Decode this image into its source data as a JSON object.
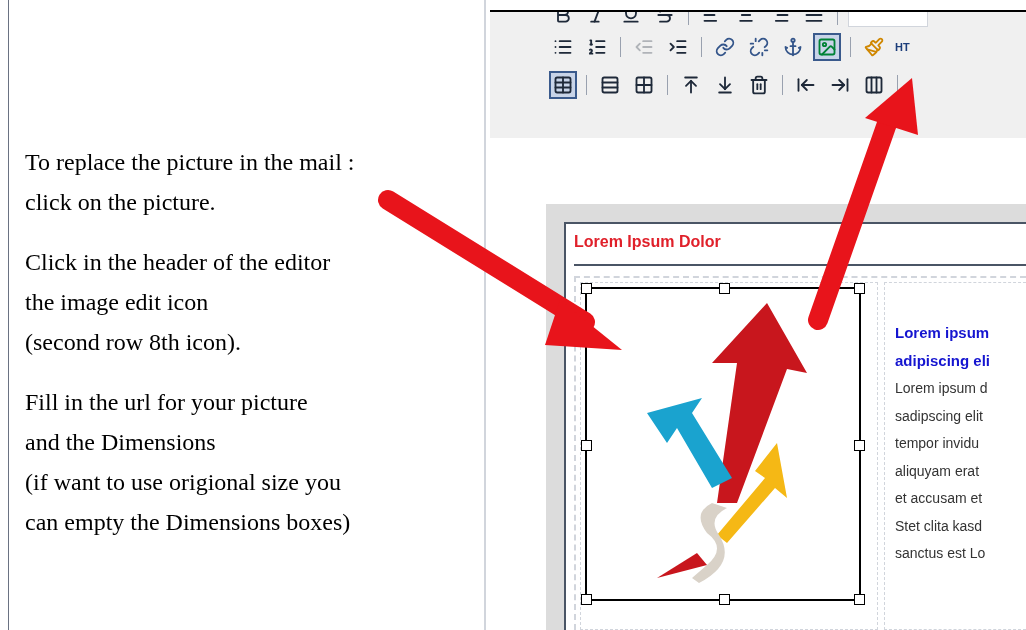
{
  "instructions": [
    [
      "To replace the picture in the mail :",
      "click on the picture."
    ],
    [
      "Click in the header of the editor",
      "the image edit icon",
      "(second row 8th icon)."
    ],
    [
      "Fill in the url for your picture",
      "and the Dimensions",
      "(if want to use origional size you",
      "can empty the Dimensions boxes)"
    ]
  ],
  "toolbar": {
    "rows": [
      [
        {
          "kind": "bold"
        },
        {
          "kind": "italic"
        },
        {
          "kind": "underline"
        },
        {
          "kind": "strike"
        },
        {
          "kind": "sep"
        },
        {
          "kind": "align-left"
        },
        {
          "kind": "align-center"
        },
        {
          "kind": "align-right"
        },
        {
          "kind": "align-justify"
        },
        {
          "kind": "sep"
        },
        {
          "kind": "font-select"
        }
      ],
      [
        {
          "kind": "bullets",
          "selected": false
        },
        {
          "kind": "numbers",
          "selected": false
        },
        {
          "kind": "sep"
        },
        {
          "kind": "outdent",
          "selected": false,
          "disabled": true
        },
        {
          "kind": "indent",
          "selected": false,
          "disabled": false
        },
        {
          "kind": "sep"
        },
        {
          "kind": "link",
          "selected": false
        },
        {
          "kind": "unlink",
          "selected": false
        },
        {
          "kind": "anchor",
          "selected": false
        },
        {
          "kind": "image",
          "selected": true
        },
        {
          "kind": "sep"
        },
        {
          "kind": "cleanup",
          "selected": false
        },
        {
          "kind": "html",
          "label": "HT"
        }
      ],
      [
        {
          "kind": "table",
          "selected": true
        },
        {
          "kind": "sep"
        },
        {
          "kind": "row-props",
          "selected": false
        },
        {
          "kind": "cell-props",
          "selected": false
        },
        {
          "kind": "sep"
        },
        {
          "kind": "row-before",
          "selected": false
        },
        {
          "kind": "row-after",
          "selected": false
        },
        {
          "kind": "row-delete",
          "selected": false
        },
        {
          "kind": "sep"
        },
        {
          "kind": "col-before",
          "selected": false
        },
        {
          "kind": "col-after",
          "selected": false
        },
        {
          "kind": "col-delete",
          "selected": false
        },
        {
          "kind": "sep"
        }
      ]
    ]
  },
  "editor": {
    "title": "Lorem Ipsum Dolor",
    "heading_lines": [
      "Lorem ipsum",
      "adipiscing eli"
    ],
    "body_lines": [
      "Lorem ipsum d",
      "sadipscing elit",
      "tempor invidu",
      "aliquyam erat",
      "et accusam et",
      "Stet clita kasd",
      "sanctus est Lo"
    ],
    "image_selected": true
  }
}
